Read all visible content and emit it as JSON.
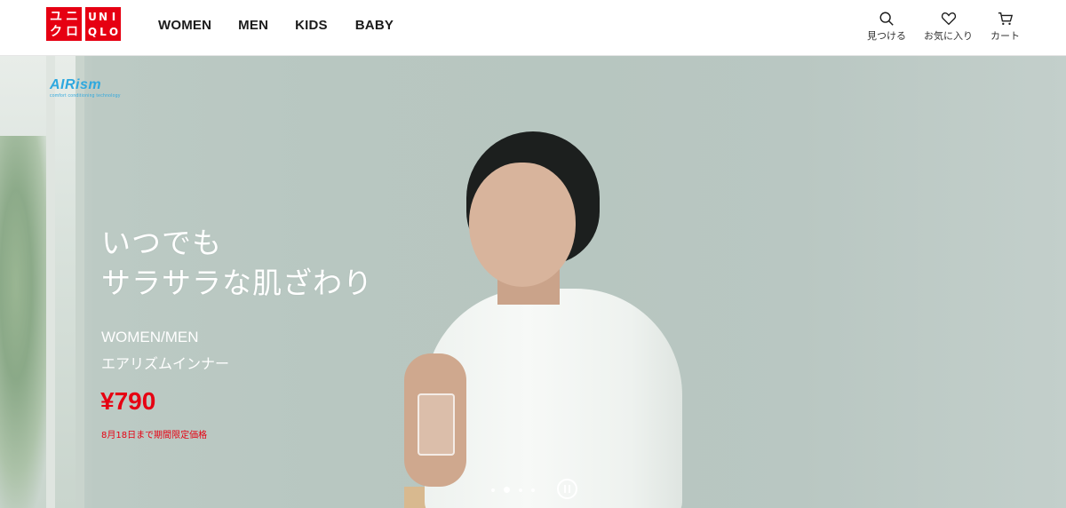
{
  "header": {
    "logo_left": [
      "ユ",
      "ニ",
      "ク",
      "ロ"
    ],
    "logo_right": [
      "U",
      "N",
      "I",
      "Q",
      "L",
      "O"
    ],
    "nav": [
      "WOMEN",
      "MEN",
      "KIDS",
      "BABY"
    ],
    "utilities": {
      "search_label": "見つける",
      "favorites_label": "お気に入り",
      "cart_label": "カート"
    }
  },
  "hero": {
    "brand_badge": "AIRism",
    "brand_tagline": "comfort conditioning technology",
    "headline_line1": "いつでも",
    "headline_line2": "サラサラな肌ざわり",
    "category": "WOMEN/MEN",
    "product_name": "エアリズムインナー",
    "price": "¥790",
    "price_note": "8月18日まで期間限定価格",
    "carousel": {
      "total_slides": 4,
      "active_slide": 2
    }
  },
  "colors": {
    "brand_red": "#e60012",
    "airism_blue": "#2ea8df"
  }
}
